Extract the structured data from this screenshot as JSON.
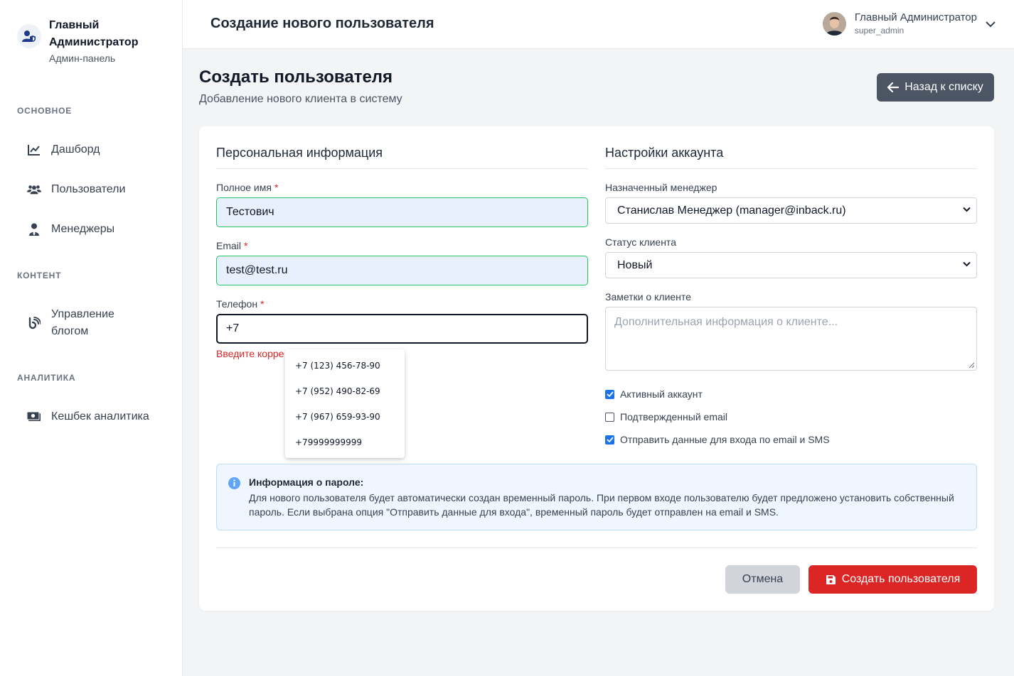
{
  "sidebar": {
    "brand_name": "Главный Администратор",
    "brand_subtitle": "Админ-панель",
    "sections": [
      {
        "title": "ОСНОВНОЕ",
        "items": [
          {
            "label": "Дашборд",
            "icon": "chart-line-icon"
          },
          {
            "label": "Пользователи",
            "icon": "users-icon"
          },
          {
            "label": "Менеджеры",
            "icon": "user-tie-icon"
          }
        ]
      },
      {
        "title": "КОНТЕНТ",
        "items": [
          {
            "label": "Управление блогом",
            "icon": "blog-icon"
          }
        ]
      },
      {
        "title": "АНАЛИТИКА",
        "items": [
          {
            "label": "Кешбек аналитика",
            "icon": "money-bill-icon"
          }
        ]
      }
    ]
  },
  "header": {
    "title": "Создание нового пользователя",
    "user_name": "Главный Администратор",
    "user_login": "super_admin"
  },
  "page": {
    "title": "Создать пользователя",
    "subtitle": "Добавление нового клиента в систему",
    "back_label": "Назад к списку"
  },
  "personal": {
    "title": "Персональная информация",
    "full_name": {
      "label": "Полное имя",
      "required": "*",
      "value": "Тестович"
    },
    "email": {
      "label": "Email",
      "required": "*",
      "value": "test@test.ru"
    },
    "phone": {
      "label": "Телефон",
      "required": "*",
      "value": "+7",
      "error": "Введите корре"
    },
    "phone_suggestions": [
      "+7 (123) 456-78-90",
      "+7 (952) 490-82-69",
      "+7 (967) 659-93-90",
      "+79999999999"
    ]
  },
  "account": {
    "title": "Настройки аккаунта",
    "manager": {
      "label": "Назначенный менеджер",
      "value": "Станислав Менеджер (manager@inback.ru)"
    },
    "status": {
      "label": "Статус клиента",
      "value": "Новый"
    },
    "notes": {
      "label": "Заметки о клиенте",
      "placeholder": "Дополнительная информация о клиенте..."
    },
    "checkboxes": [
      {
        "label": "Активный аккаунт",
        "checked": true
      },
      {
        "label": "Подтвержденный email",
        "checked": false
      },
      {
        "label": "Отправить данные для входа по email и SMS",
        "checked": true
      }
    ]
  },
  "info": {
    "title": "Информация о пароле:",
    "text": "Для нового пользователя будет автоматически создан временный пароль. При первом входе пользователю будет предложено установить собственный пароль. Если выбрана опция \"Отправить данные для входа\", временный пароль будет отправлен на email и SMS."
  },
  "actions": {
    "cancel_label": "Отмена",
    "submit_label": "Создать пользователя"
  },
  "colors": {
    "accent_red": "#dc2626",
    "back_button": "#4b5563",
    "valid_border": "#22c55e",
    "checkbox_blue": "#1a73e8",
    "info_bg": "#eff6ff"
  }
}
